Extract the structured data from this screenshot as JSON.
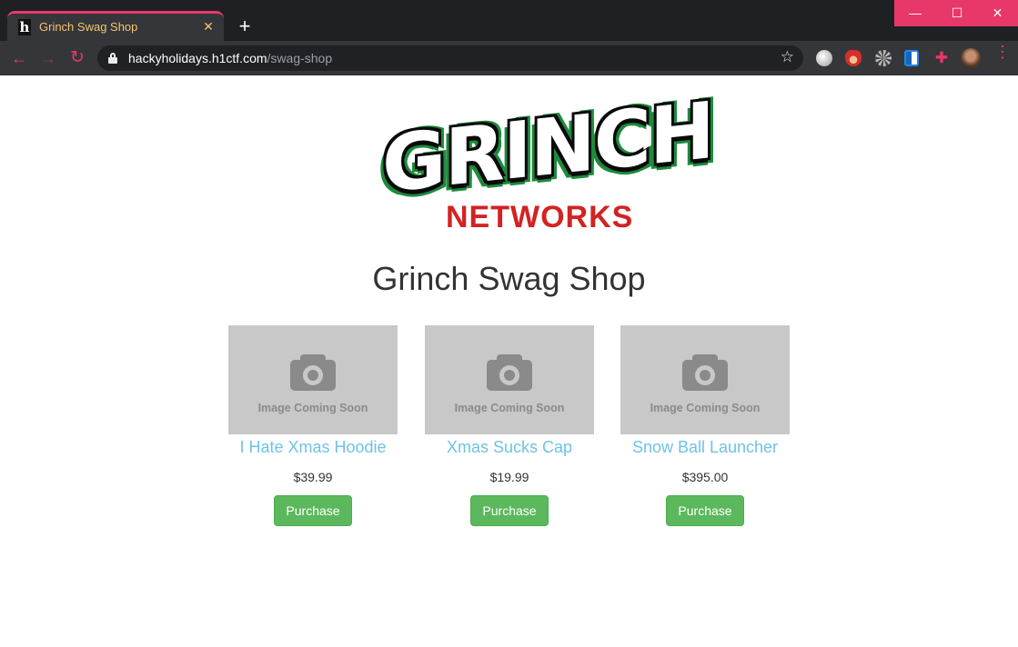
{
  "browser": {
    "tab_title": "Grinch Swag Shop",
    "tab_favicon": "h",
    "tab_close": "✕",
    "new_tab": "+",
    "window_controls": {
      "minimize": "—",
      "maximize": "☐",
      "close": "✕"
    },
    "nav": {
      "back": "←",
      "forward": "→",
      "reload": "↻"
    },
    "url_host": "hackyholidays.h1ctf.com",
    "url_path": "/swag-shop",
    "bookmark_icon": "☆",
    "extensions": [
      "globe-extension-icon",
      "santa-extension-icon",
      "gear-extension-icon",
      "shield-extension-icon",
      "puzzle-extension-icon",
      "profile-avatar-icon"
    ],
    "puzzle_glyph": "✚",
    "menu": "⋮"
  },
  "logo": {
    "word": "GRINCH",
    "sub": "NETWORKS",
    "colors": {
      "outline": "#0a0a0a",
      "glow": "#1d8a3c",
      "sub": "#d22323"
    }
  },
  "page_title": "Grinch Swag Shop",
  "placeholder_text": "Image Coming Soon",
  "products": [
    {
      "name": "I Hate Xmas Hoodie",
      "price": "$39.99",
      "button": "Purchase"
    },
    {
      "name": "Xmas Sucks Cap",
      "price": "$19.99",
      "button": "Purchase"
    },
    {
      "name": "Snow Ball Launcher",
      "price": "$395.00",
      "button": "Purchase"
    }
  ],
  "colors": {
    "accent": "#e8386b",
    "link": "#6ec2e8",
    "button": "#5cb85c"
  }
}
